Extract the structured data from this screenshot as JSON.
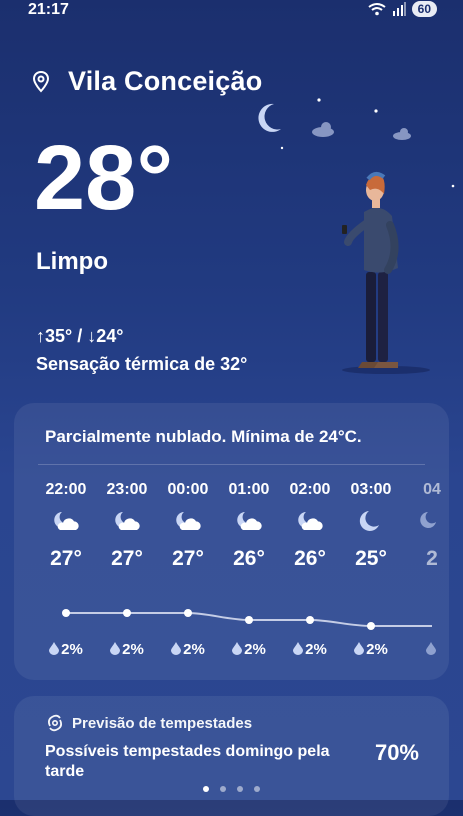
{
  "status_bar": {
    "time": "21:17",
    "battery": "60"
  },
  "location": {
    "name": "Vila Conceição"
  },
  "current": {
    "temperature": "28°",
    "condition": "Limpo",
    "high_low": "↑35° / ↓24°",
    "feels_like": "Sensação térmica de 32°"
  },
  "hourly": {
    "summary": "Parcialmente nublado. Mínima de 24°C.",
    "hours": [
      {
        "time": "22:00",
        "icon": "partly-cloudy-night-icon",
        "temp": "27°",
        "precip": "2%"
      },
      {
        "time": "23:00",
        "icon": "partly-cloudy-night-icon",
        "temp": "27°",
        "precip": "2%"
      },
      {
        "time": "00:00",
        "icon": "partly-cloudy-night-icon",
        "temp": "27°",
        "precip": "2%"
      },
      {
        "time": "01:00",
        "icon": "partly-cloudy-night-icon",
        "temp": "26°",
        "precip": "2%"
      },
      {
        "time": "02:00",
        "icon": "partly-cloudy-night-icon",
        "temp": "26°",
        "precip": "2%"
      },
      {
        "time": "03:00",
        "icon": "clear-night-icon",
        "temp": "25°",
        "precip": "2%"
      },
      {
        "time": "04",
        "icon": "partly-cloudy-night-icon",
        "temp": "2",
        "precip": ""
      }
    ]
  },
  "storm": {
    "title": "Previsão de tempestades",
    "description": "Possíveis tempestades domingo pela tarde",
    "probability": "70%"
  },
  "colors": {
    "background_top": "#1b2f6e",
    "background_bottom": "#2c4791",
    "moon": "#c9d6f5"
  }
}
